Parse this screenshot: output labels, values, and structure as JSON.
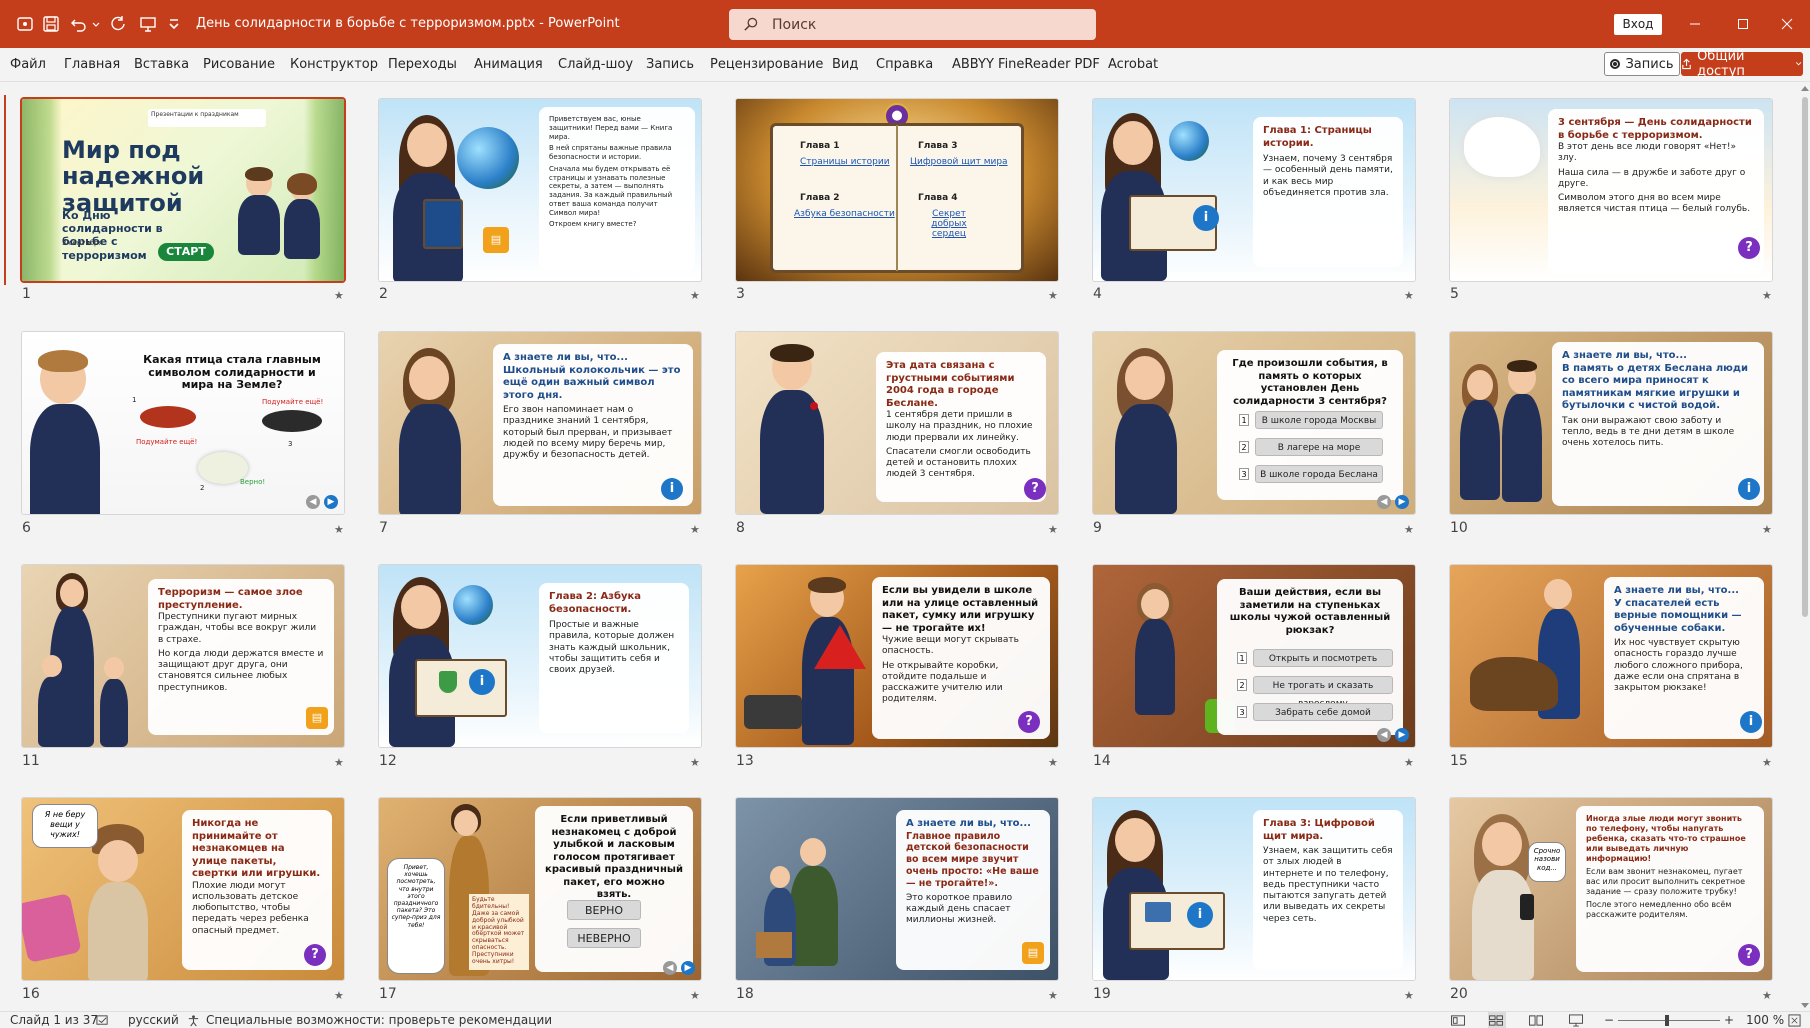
{
  "app": {
    "title": "День солидарности в борьбе с терроризмом.pptx  -  PowerPoint",
    "search_placeholder": "Поиск",
    "signin_label": "Вход"
  },
  "menu": [
    "Файл",
    "Главная",
    "Вставка",
    "Рисование",
    "Конструктор",
    "Переходы",
    "Анимация",
    "Слайд-шоу",
    "Запись",
    "Рецензирование",
    "Вид",
    "Справка",
    "ABBYY FineReader PDF",
    "Acrobat"
  ],
  "toolbar": {
    "record_label": "Запись",
    "share_label": "Общий доступ"
  },
  "slides": [
    {
      "num": "1",
      "title": "Мир под надежной защитой",
      "subtitle": "Ко Дню солидарности в борьбе с терроризмом",
      "date": "3 сентября",
      "button": "СТАРТ",
      "logo": "Презентации к праздникам"
    },
    {
      "num": "2",
      "lines": [
        "Приветствуем вас, юные защитники! Перед вами — Книга мира.",
        "В ней спрятаны важные правила безопасности и истории.",
        "Сначала мы будем открывать её страницы и узнавать полезные секреты, а затем — выполнять задания. За каждый правильный ответ ваша команда получит Символ мира!",
        "Откроем книгу вместе?"
      ]
    },
    {
      "num": "3",
      "chapters": [
        {
          "label": "Глава 1",
          "link": "Страницы истории"
        },
        {
          "label": "Глава 3",
          "link": "Цифровой щит мира"
        },
        {
          "label": "Глава 2",
          "link": "Азбука безопасности"
        },
        {
          "label": "Глава 4",
          "link": "Секрет добрых сердец"
        }
      ]
    },
    {
      "num": "4",
      "heading": "Глава 1: Страницы истории.",
      "text": "Узнаем, почему 3 сентября — особенный день памяти, и как весь мир объединяется против зла."
    },
    {
      "num": "5",
      "heading": "3 сентября — День солидарности в борьбе с терроризмом.",
      "lines": [
        "В этот день все люди говорят «Нет!» злу.",
        "Наша сила — в дружбе и заботе друг о друге.",
        "Символом этого дня во всем мире является чистая птица — белый голубь."
      ]
    },
    {
      "num": "6",
      "heading": "Какая птица стала главным символом солидарности и мира на Земле?",
      "hints": [
        "Подумайте ещё!",
        "Подумайте ещё!",
        "Верно!"
      ],
      "nums": [
        "1",
        "2",
        "3"
      ]
    },
    {
      "num": "7",
      "heading": "А знаете ли вы, что...",
      "sub": "Школьный колокольчик — это ещё один важный символ этого дня.",
      "text": "Его звон напоминает нам о празднике знаний 1 сентября, который был прерван, и призывает людей по всему миру беречь мир, дружбу и безопасность детей."
    },
    {
      "num": "8",
      "heading": "Эта дата связана с грустными событиями 2004 года в городе Беслане.",
      "lines": [
        "1 сентября дети пришли в школу на праздник, но плохие люди прервали их линейку.",
        "Спасатели смогли освободить детей и остановить плохих людей 3 сентября."
      ]
    },
    {
      "num": "9",
      "heading": "Где произошли события, в память о которых установлен День солидарности 3 сентября?",
      "options": [
        "В школе города Москвы",
        "В лагере на море",
        "В школе города Беслана"
      ],
      "nums": [
        "1",
        "2",
        "3"
      ]
    },
    {
      "num": "10",
      "heading": "А знаете ли вы, что...",
      "sub": "В память о детях Беслана люди со всего мира приносят к памятникам мягкие игрушки и бутылочки с чистой водой.",
      "text": "Так они выражают свою заботу и тепло, ведь в те дни детям в школе очень хотелось пить."
    },
    {
      "num": "11",
      "heading": "Терроризм — самое злое преступление.",
      "lines": [
        "Преступники пугают мирных граждан, чтобы все вокруг жили в страхе.",
        "Но когда люди держатся вместе и защищают друг друга, они становятся сильнее любых преступников."
      ]
    },
    {
      "num": "12",
      "heading": "Глава 2: Азбука безопасности.",
      "text": "Простые и важные правила, которые должен знать каждый школьник, чтобы защитить себя и своих друзей."
    },
    {
      "num": "13",
      "heading": "Если вы увидели в школе или на улице оставленный пакет, сумку или игрушку — не трогайте их!",
      "lines": [
        "Чужие вещи могут скрывать опасность.",
        "Не открывайте коробки, отойдите подальше и расскажите учителю или родителям."
      ]
    },
    {
      "num": "14",
      "heading": "Ваши действия, если вы заметили на ступеньках школы чужой оставленный рюкзак?",
      "options": [
        "Открыть и посмотреть",
        "Не трогать и сказать взрослому",
        "Забрать себе домой"
      ],
      "nums": [
        "1",
        "2",
        "3"
      ]
    },
    {
      "num": "15",
      "heading": "А знаете ли вы, что...",
      "sub": "У спасателей есть верные помощники — обученные собаки.",
      "text": "Их нос чувствует скрытую опасность гораздо лучше любого сложного прибора, даже если она спрятана в закрытом рюкзаке!"
    },
    {
      "num": "16",
      "bubble": "Я не беру вещи у чужих!",
      "heading": "Никогда не принимайте от незнакомцев на улице пакеты, свертки или игрушки.",
      "text": "Плохие люди могут использовать детское любопытство, чтобы передать через ребенка опасный предмет."
    },
    {
      "num": "17",
      "heading": "Если приветливый незнакомец с доброй улыбкой и ласковым голосом протягивает красивый праздничный пакет, его можно взять.",
      "bubble": "Привет, хочешь посмотреть, что внутри этого праздничного пакета? Это супер-приз для тебя!",
      "note": "Будьте бдительны! Даже за самой доброй улыбкой и красивой обёрткой может скрываться опасность. Преступники очень хитры!",
      "options": [
        "ВЕРНО",
        "НЕВЕРНО"
      ]
    },
    {
      "num": "18",
      "heading": "А знаете ли вы, что...",
      "sub": "Главное правило детской безопасности во всем мире звучит очень просто: «Не ваше — не трогайте!».",
      "text": "Это короткое правило каждый день спасает миллионы жизней."
    },
    {
      "num": "19",
      "heading": "Глава 3: Цифровой щит мира.",
      "text": "Узнаем, как защитить себя от злых людей в интернете и по телефону, ведь преступники часто пытаются запугать детей или выведать их секреты через сеть."
    },
    {
      "num": "20",
      "bubble": "Срочно назови код...",
      "lines": [
        "Иногда злые люди могут звонить по телефону, чтобы напугать ребенка, сказать что-то страшное или выведать личную информацию!",
        "Если вам звонит незнакомец, пугает вас или просит выполнить секретное задание — сразу положите трубку!",
        "После этого немедленно обо всём расскажите родителям."
      ]
    }
  ],
  "status": {
    "slide_info": "Слайд 1 из 37",
    "language": "русский",
    "accessibility": "Специальные возможности: проверьте рекомендации",
    "zoom": "100 %"
  },
  "colors": {
    "accent": "#c43e1c",
    "search_bg": "#f6d8cf",
    "background": "#f3f3f3"
  }
}
